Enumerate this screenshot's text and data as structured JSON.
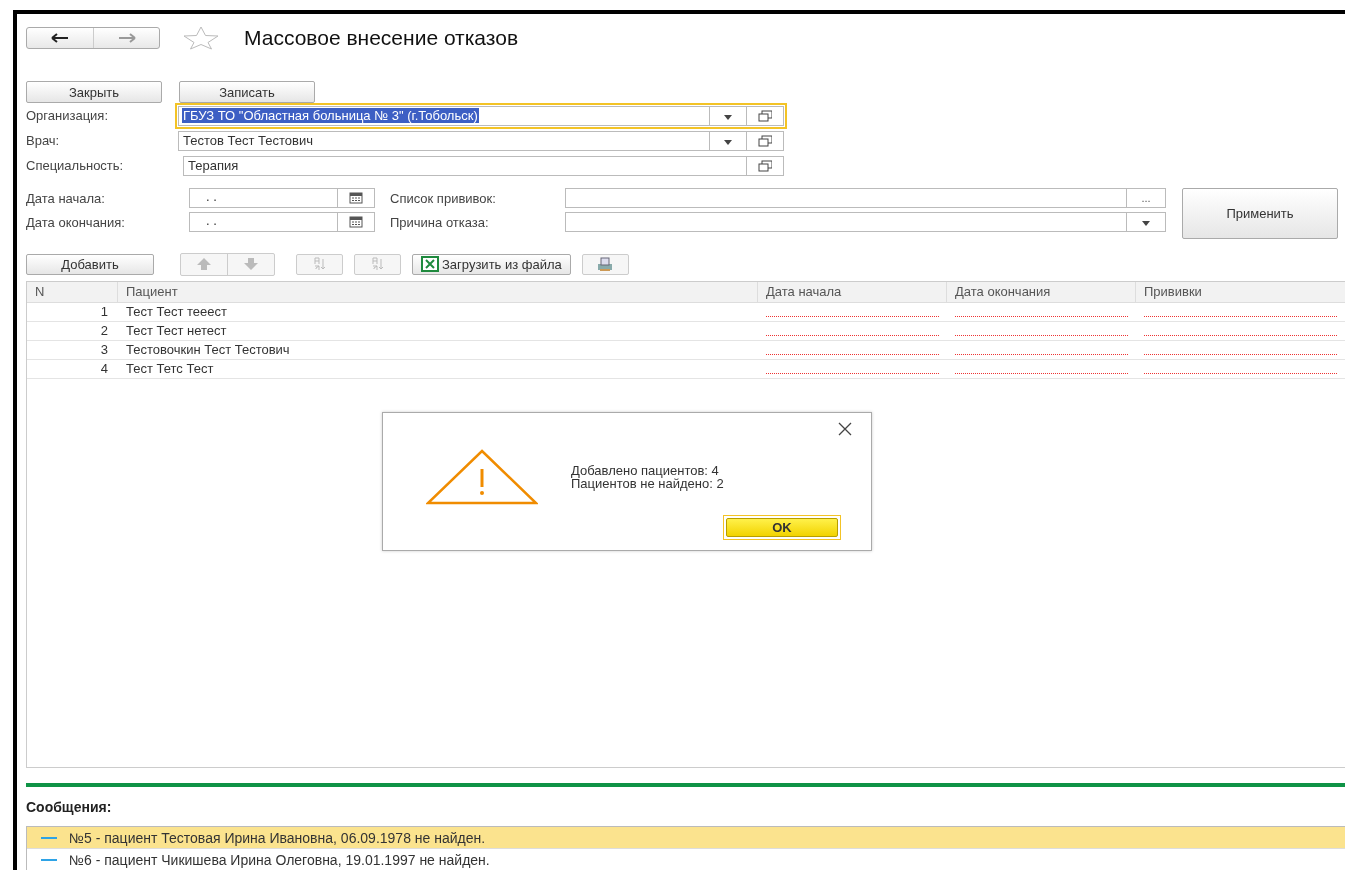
{
  "window": {
    "title": "Массовое внесение отказов",
    "favorite": false
  },
  "buttons": [
    {
      "label": "Закрыть"
    },
    {
      "label": "Записать"
    }
  ],
  "fields": [
    {
      "label": "Организация:",
      "value": "ГБУЗ ТО \"Областная больница № 3\" (г.Тобольск)",
      "focused": true,
      "text_selected": true,
      "dropdown": true
    },
    {
      "label": "Врач:",
      "value": "Тестов Тест Тестович",
      "focused": false,
      "text_selected": false,
      "dropdown": true
    },
    {
      "label": "Специальность:",
      "value": "Терапия",
      "focused": false,
      "text_selected": false,
      "dropdown": false
    }
  ],
  "filters": {
    "date_start": {
      "label": "Дата начала:",
      "value": ". ."
    },
    "date_end": {
      "label": "Дата окончания:",
      "value": ". ."
    },
    "vaccines": {
      "label": "Список прививок:",
      "button": "..."
    },
    "reason": {
      "label": "Причина отказа:"
    },
    "apply_button": "Применить"
  },
  "toolbar": {
    "add_button": "Добавить",
    "load_button": "Загрузить из файла"
  },
  "table": {
    "columns": [
      {
        "label": "N",
        "required": false
      },
      {
        "label": "Пациент",
        "required": false
      },
      {
        "label": "Дата начала",
        "required": true
      },
      {
        "label": "Дата окончания",
        "required": true
      },
      {
        "label": "Прививки",
        "required": true
      }
    ],
    "rows": [
      {
        "n": "1",
        "patient": "Тест Тест тееест"
      },
      {
        "n": "2",
        "patient": "Тест Тест нетест"
      },
      {
        "n": "3",
        "patient": "Тестовочкин Тест Тестович"
      },
      {
        "n": "4",
        "patient": "Тест Тетс Тест"
      }
    ]
  },
  "messages": {
    "title": "Сообщения:",
    "items": [
      {
        "text": "№5 - пациент Тестовая Ирина Ивановна, 06.09.1978 не найден.",
        "selected": true
      },
      {
        "text": "№6 - пациент Чикишева Ирина Олеговна, 19.01.1997 не найден.",
        "selected": false
      }
    ]
  },
  "dialog": {
    "lines": [
      "Добавлено пациентов: 4",
      "Пациентов не найдено: 2"
    ],
    "button": "OK"
  }
}
